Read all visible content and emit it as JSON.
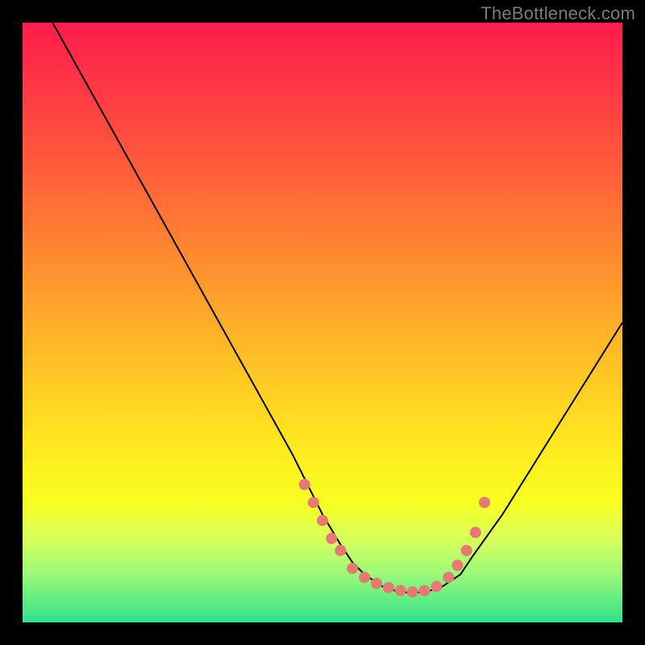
{
  "watermark": "TheBottleneck.com",
  "chart_data": {
    "type": "line",
    "title": "",
    "xlabel": "",
    "ylabel": "",
    "xlim": [
      0,
      100
    ],
    "ylim": [
      0,
      100
    ],
    "series": [
      {
        "name": "curve",
        "x": [
          5,
          10,
          15,
          20,
          25,
          30,
          35,
          40,
          45,
          48,
          50,
          53,
          55,
          57,
          60,
          63,
          65,
          67,
          70,
          73,
          75,
          80,
          85,
          90,
          95,
          100
        ],
        "y": [
          100,
          91,
          82,
          73,
          64,
          55,
          46,
          37,
          28,
          22,
          18,
          13,
          10,
          8,
          6,
          5,
          5,
          5,
          6,
          8,
          11,
          18,
          26,
          34,
          42,
          50
        ]
      },
      {
        "name": "markers",
        "x": [
          47,
          48.5,
          50,
          51.5,
          53,
          55,
          57,
          59,
          61,
          63,
          65,
          67,
          69,
          71,
          72.5,
          74,
          75.5,
          77
        ],
        "y": [
          23,
          20,
          17,
          14,
          12,
          9,
          7.5,
          6.5,
          5.8,
          5.3,
          5.1,
          5.3,
          6,
          7.5,
          9.5,
          12,
          15,
          20
        ]
      }
    ],
    "marker_color": "#e47a72",
    "line_color": "#000000"
  }
}
